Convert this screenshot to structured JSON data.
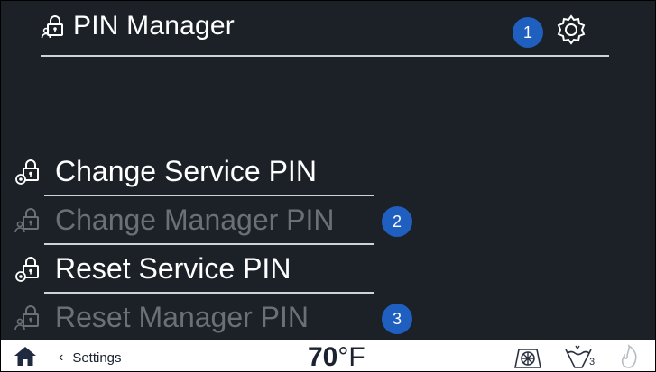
{
  "header": {
    "title": "PIN Manager",
    "icon": "lock-person-icon",
    "settings_icon": "gear-icon"
  },
  "badges": [
    "1",
    "2",
    "3"
  ],
  "menu": {
    "items": [
      {
        "label": "Change Service PIN",
        "icon": "lock-gear-icon",
        "enabled": true
      },
      {
        "label": "Change Manager PIN",
        "icon": "lock-person-icon",
        "enabled": false
      },
      {
        "label": "Reset Service PIN",
        "icon": "lock-gear-icon",
        "enabled": true
      },
      {
        "label": "Reset Manager PIN",
        "icon": "lock-person-icon",
        "enabled": false
      }
    ]
  },
  "bottom_bar": {
    "home_icon": "home-icon",
    "back_label": "Settings",
    "temperature_value": "70",
    "temperature_unit": "°F",
    "icons": [
      "fan-icon",
      "water-level-icon",
      "flame-icon"
    ],
    "water_level_subscript": "3"
  },
  "colors": {
    "background": "#1c2128",
    "badge": "#1f5fc0",
    "text_enabled": "#ffffff",
    "text_disabled": "#6b7078"
  }
}
